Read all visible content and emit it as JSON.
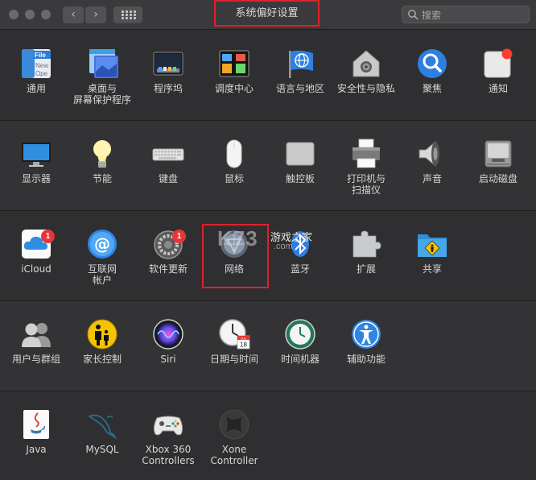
{
  "window": {
    "title": "系统偏好设置",
    "search_placeholder": "搜索",
    "back_glyph": "‹",
    "forward_glyph": "›"
  },
  "colors": {
    "window_bg": "#2f2f31",
    "titlebar_bg": "#3a3a3c",
    "highlight": "#e0202a",
    "badge": "#e5363a",
    "label": "#d6d6d6"
  },
  "rows": [
    {
      "items": [
        {
          "label": "通用",
          "icon": "general-icon"
        },
        {
          "label": "桌面与\n屏幕保护程序",
          "icon": "desktop-screensaver-icon"
        },
        {
          "label": "程序坞",
          "icon": "dock-icon"
        },
        {
          "label": "调度中心",
          "icon": "mission-control-icon"
        },
        {
          "label": "语言与地区",
          "icon": "language-region-icon"
        },
        {
          "label": "安全性与隐私",
          "icon": "security-privacy-icon"
        },
        {
          "label": "聚焦",
          "icon": "spotlight-icon"
        },
        {
          "label": "通知",
          "icon": "notifications-icon"
        }
      ]
    },
    {
      "items": [
        {
          "label": "显示器",
          "icon": "displays-icon"
        },
        {
          "label": "节能",
          "icon": "energy-saver-icon"
        },
        {
          "label": "键盘",
          "icon": "keyboard-icon"
        },
        {
          "label": "鼠标",
          "icon": "mouse-icon"
        },
        {
          "label": "触控板",
          "icon": "trackpad-icon"
        },
        {
          "label": "打印机与\n扫描仪",
          "icon": "printers-scanners-icon"
        },
        {
          "label": "声音",
          "icon": "sound-icon"
        },
        {
          "label": "启动磁盘",
          "icon": "startup-disk-icon"
        }
      ]
    },
    {
      "items": [
        {
          "label": "iCloud",
          "icon": "icloud-icon",
          "badge": "1"
        },
        {
          "label": "互联网\n帐户",
          "icon": "internet-accounts-icon"
        },
        {
          "label": "软件更新",
          "icon": "software-update-icon",
          "badge": "1"
        },
        {
          "label": "网络",
          "icon": "network-icon"
        },
        {
          "label": "蓝牙",
          "icon": "bluetooth-icon"
        },
        {
          "label": "扩展",
          "icon": "extensions-icon"
        },
        {
          "label": "共享",
          "icon": "sharing-icon"
        }
      ]
    },
    {
      "items": [
        {
          "label": "用户与群组",
          "icon": "users-groups-icon"
        },
        {
          "label": "家长控制",
          "icon": "parental-controls-icon"
        },
        {
          "label": "Siri",
          "icon": "siri-icon"
        },
        {
          "label": "日期与时间",
          "icon": "date-time-icon"
        },
        {
          "label": "时间机器",
          "icon": "time-machine-icon"
        },
        {
          "label": "辅助功能",
          "icon": "accessibility-icon"
        }
      ]
    },
    {
      "items": [
        {
          "label": "Java",
          "icon": "java-icon"
        },
        {
          "label": "MySQL",
          "icon": "mysql-icon"
        },
        {
          "label": "Xbox 360\nControllers",
          "icon": "xbox-360-controllers-icon"
        },
        {
          "label": "Xone Controller",
          "icon": "xone-controller-icon"
        }
      ]
    }
  ],
  "icon_text": {
    "general_file": "File",
    "general_new": "New",
    "general_ope": "Ope",
    "calendar_month": "JUL",
    "calendar_day": "18"
  },
  "watermark": {
    "brand": "K73",
    "name": "游戏之家",
    "domain": ".com"
  }
}
